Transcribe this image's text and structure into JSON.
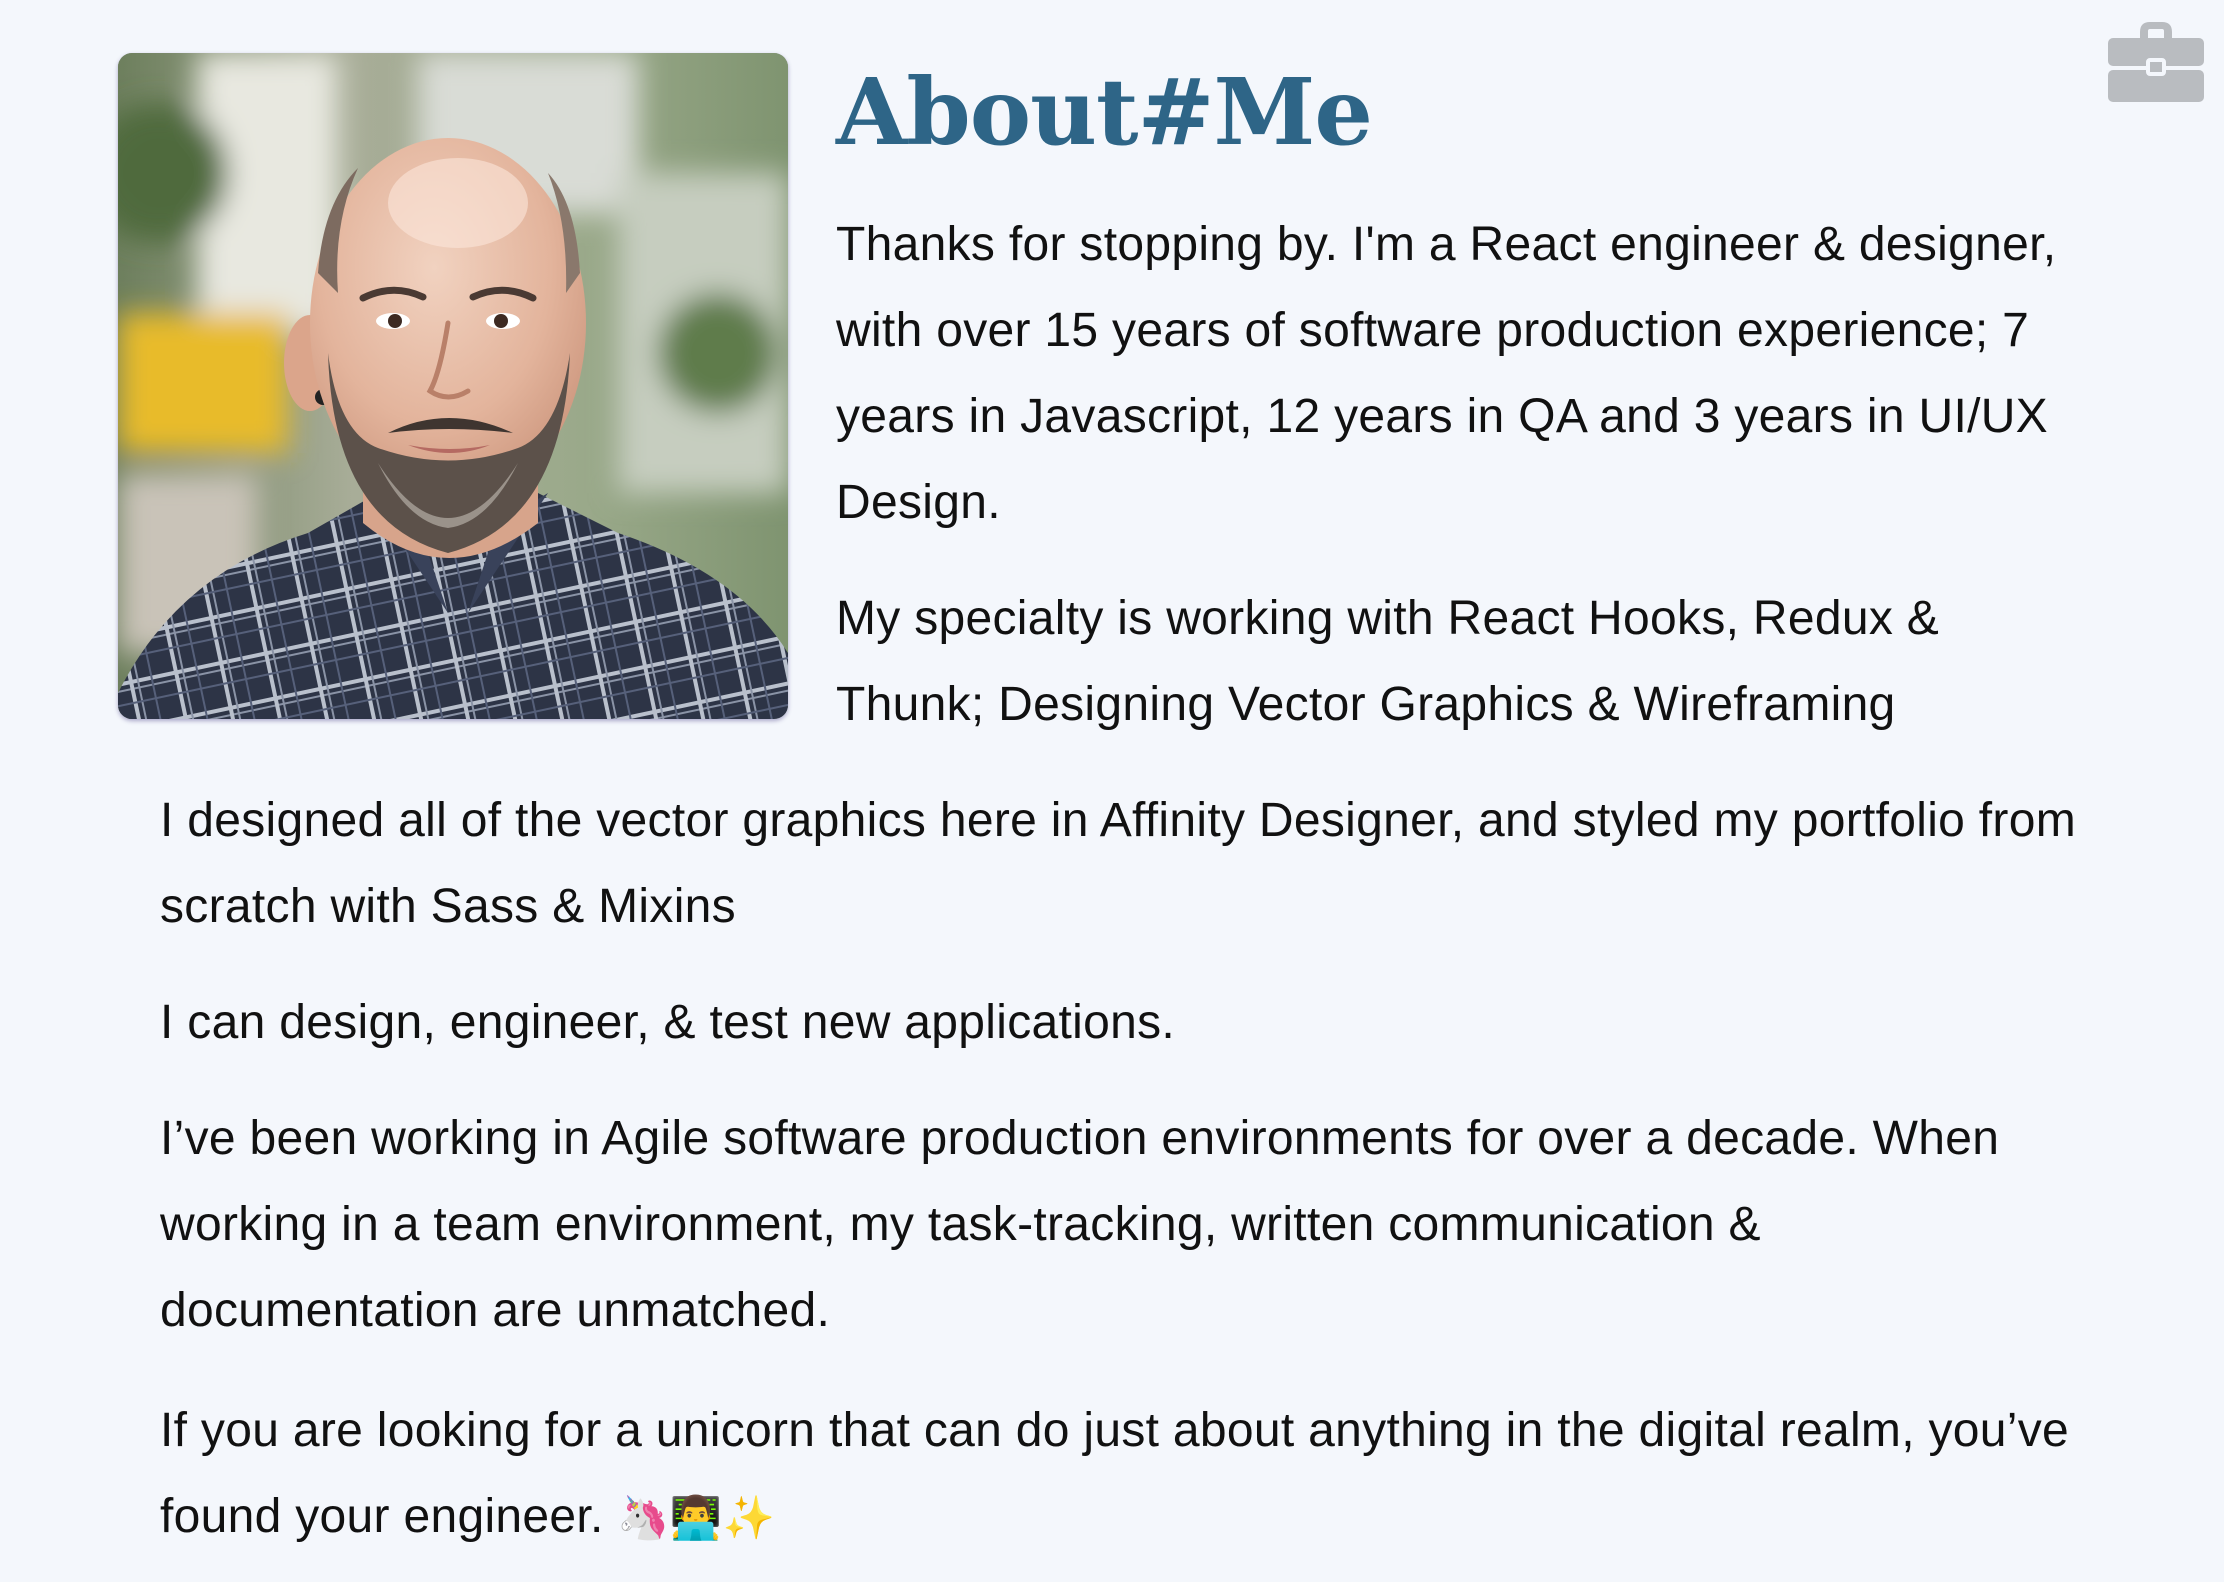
{
  "header": {
    "title": "About#Me"
  },
  "icons": {
    "portfolio": "briefcase-icon"
  },
  "profile": {
    "photo": "profile-portrait-photo"
  },
  "paragraphs": {
    "p1": "Thanks for stopping by. I'm a React engineer & designer, with over 15 years of software production experience; 7 years in Javascript, 12 years in QA and 3 years in UI/UX Design.",
    "p2": "My specialty is working with React Hooks, Redux & Thunk; Designing Vector Graphics & Wireframing",
    "p3": "I designed all of the vector graphics here in Affinity Designer, and styled my portfolio from scratch with Sass & Mixins",
    "p4": "I can design, engineer, & test new applications.",
    "p5": "I’ve been working in Agile software production environments for over a decade. When working in a team environment, my task-tracking, written communication & documentation are unmatched.",
    "p6": "If you are looking for a unicorn that can do just about anything in the digital realm, you’ve found your engineer.",
    "p6_emoji": "🦄👨‍💻✨"
  },
  "colors": {
    "background": "#f4f7fc",
    "heading": "#2e6587",
    "text": "#111111",
    "icon": "#b9bcc0"
  }
}
